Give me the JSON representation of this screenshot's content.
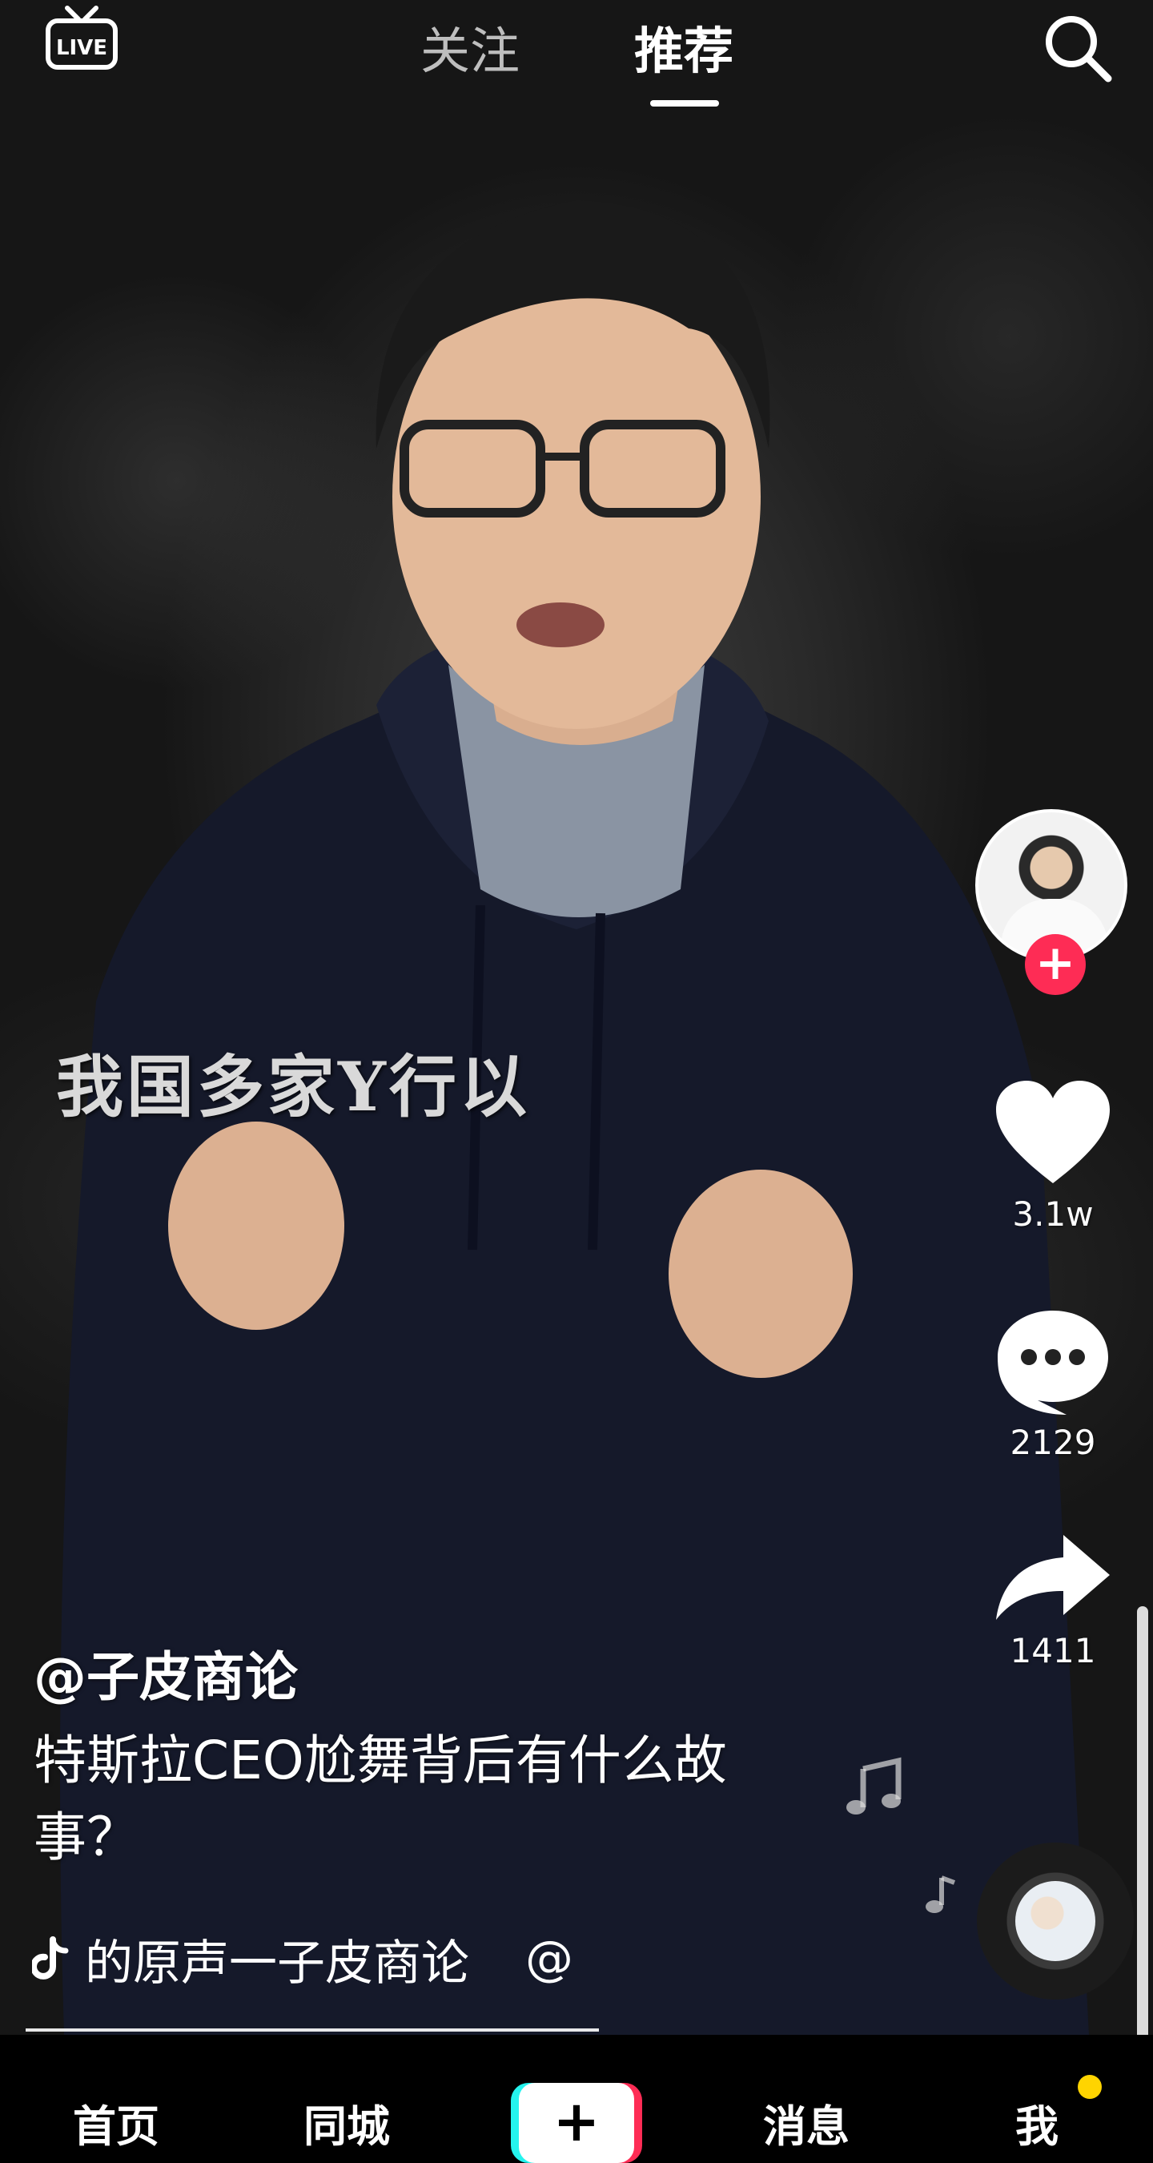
{
  "top_bar": {
    "live_icon": "live-tv-icon",
    "tabs": [
      {
        "label": "关注",
        "active": false
      },
      {
        "label": "推荐",
        "active": true
      }
    ],
    "search_icon": "search-icon"
  },
  "video": {
    "subtitle": "我国多家Y行以"
  },
  "side_actions": {
    "like_count": "3.1w",
    "comment_count": "2129",
    "share_count": "1411"
  },
  "post": {
    "author": "@子皮商论",
    "description": "特斯拉CEO尬舞背后有什么故事？",
    "music": "的原声一子皮商论",
    "music_suffix": "@"
  },
  "bottom_nav": {
    "home": "首页",
    "city": "同城",
    "create": "+",
    "messages": "消息",
    "me": "我"
  },
  "colors": {
    "accent_red": "#fe2c55",
    "accent_cyan": "#25f4ee",
    "notification_dot": "#ffd400"
  }
}
